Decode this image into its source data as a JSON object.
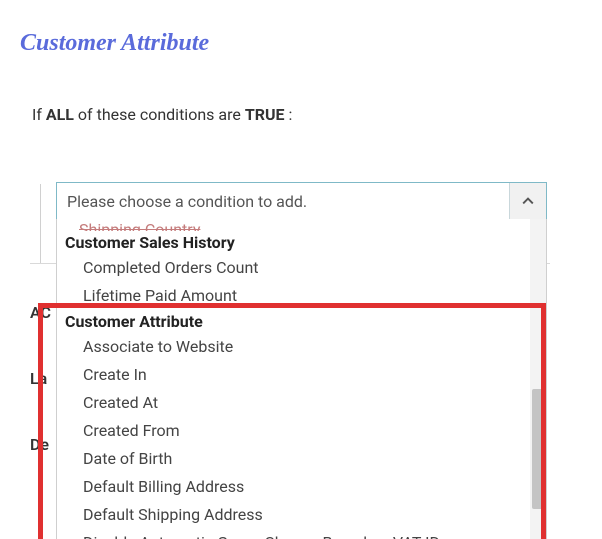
{
  "section_title": "Customer Attribute",
  "rule": {
    "prefix": "If ",
    "all": "ALL",
    "middle": " of these conditions are ",
    "true": "TRUE",
    "suffix": " :"
  },
  "combo": {
    "placeholder": "Please choose a condition to add."
  },
  "bg_hints": [
    "AC",
    "La",
    "De"
  ],
  "dropdown": {
    "cut_item": "Shipping Country",
    "groups": [
      {
        "label": "Customer Sales History",
        "items": [
          "Completed Orders Count",
          "Lifetime Paid Amount"
        ]
      },
      {
        "label": "Customer Attribute",
        "items": [
          "Associate to Website",
          "Create In",
          "Created At",
          "Created From",
          "Date of Birth",
          "Default Billing Address",
          "Default Shipping Address",
          "Disable Automatic Group Change Based on VAT ID"
        ]
      }
    ]
  }
}
